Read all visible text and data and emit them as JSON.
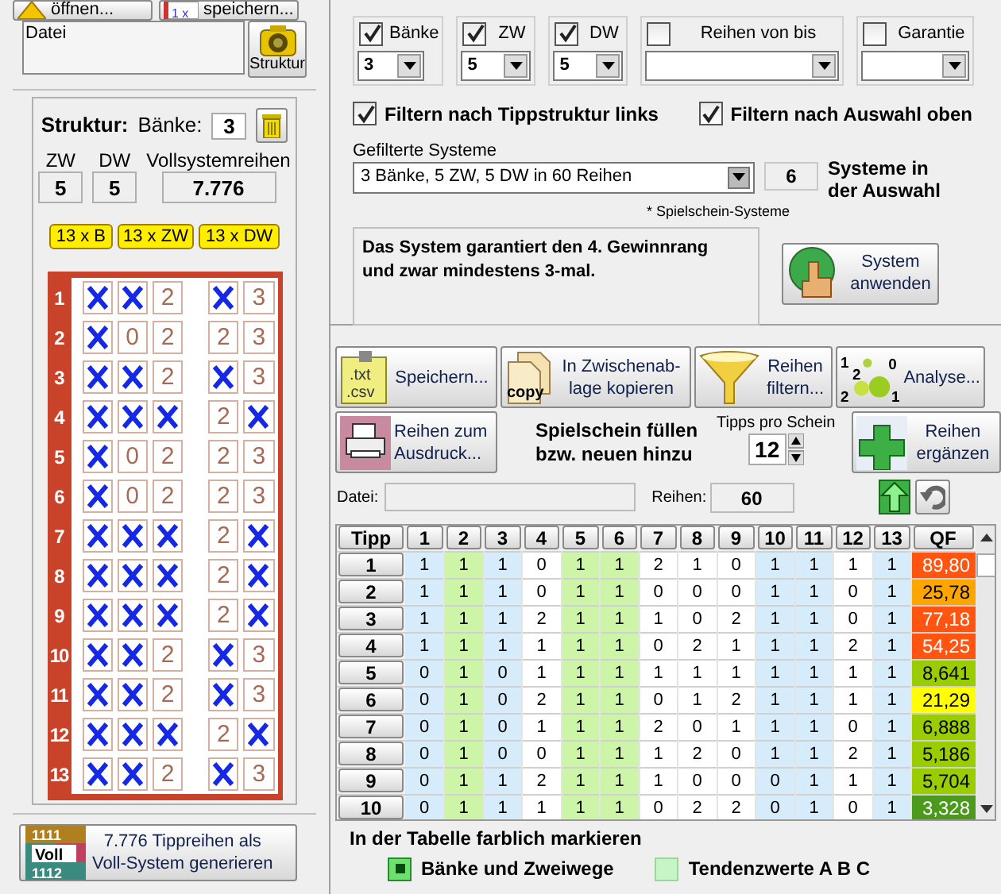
{
  "file_buttons": [
    {
      "label": "öffnen..."
    },
    {
      "label": "speichern...",
      "icon_text": "1 x"
    }
  ],
  "file": {
    "label": "Datei"
  },
  "structure_button": {
    "label": "Struktur"
  },
  "structure": {
    "title": "Struktur:",
    "banks_label": "Bänke:",
    "banks": "3",
    "zw_label": "ZW",
    "zw": "5",
    "dw_label": "DW",
    "dw": "5",
    "full_label": "Vollsystemreihen",
    "full": "7.776"
  },
  "fill_buttons": [
    "13 x B",
    "13 x ZW",
    "13 x DW"
  ],
  "ticket": {
    "rows": [
      {
        "number": "1",
        "cells": [
          {
            "crossed": true
          },
          {
            "crossed": true
          },
          {
            "digit": "2",
            "crossed": false
          },
          {
            "crossed": true
          },
          {
            "digit": "3",
            "crossed": false
          }
        ]
      },
      {
        "number": "2",
        "cells": [
          {
            "crossed": true
          },
          {
            "digit": "0",
            "crossed": false
          },
          {
            "digit": "2",
            "crossed": false
          },
          {
            "digit": "2",
            "crossed": false
          },
          {
            "digit": "3",
            "crossed": false
          }
        ]
      },
      {
        "number": "3",
        "cells": [
          {
            "crossed": true
          },
          {
            "crossed": true
          },
          {
            "digit": "2",
            "crossed": false
          },
          {
            "crossed": true
          },
          {
            "digit": "3",
            "crossed": false
          }
        ]
      },
      {
        "number": "4",
        "cells": [
          {
            "crossed": true
          },
          {
            "crossed": true
          },
          {
            "crossed": true
          },
          {
            "digit": "2",
            "crossed": false
          },
          {
            "crossed": true
          }
        ]
      },
      {
        "number": "5",
        "cells": [
          {
            "crossed": true
          },
          {
            "digit": "0",
            "crossed": false
          },
          {
            "digit": "2",
            "crossed": false
          },
          {
            "digit": "2",
            "crossed": false
          },
          {
            "digit": "3",
            "crossed": false
          }
        ]
      },
      {
        "number": "6",
        "cells": [
          {
            "crossed": true
          },
          {
            "digit": "0",
            "crossed": false
          },
          {
            "digit": "2",
            "crossed": false
          },
          {
            "digit": "2",
            "crossed": false
          },
          {
            "digit": "3",
            "crossed": false
          }
        ]
      },
      {
        "number": "7",
        "cells": [
          {
            "crossed": true
          },
          {
            "crossed": true
          },
          {
            "crossed": true
          },
          {
            "digit": "2",
            "crossed": false
          },
          {
            "crossed": true
          }
        ]
      },
      {
        "number": "8",
        "cells": [
          {
            "crossed": true
          },
          {
            "crossed": true
          },
          {
            "crossed": true
          },
          {
            "digit": "2",
            "crossed": false
          },
          {
            "crossed": true
          }
        ]
      },
      {
        "number": "9",
        "cells": [
          {
            "crossed": true
          },
          {
            "crossed": true
          },
          {
            "crossed": true
          },
          {
            "digit": "2",
            "crossed": false
          },
          {
            "crossed": true
          }
        ]
      },
      {
        "number": "10",
        "cells": [
          {
            "crossed": true
          },
          {
            "crossed": true
          },
          {
            "digit": "2",
            "crossed": false
          },
          {
            "crossed": true
          },
          {
            "digit": "3",
            "crossed": false
          }
        ]
      },
      {
        "number": "11",
        "cells": [
          {
            "crossed": true
          },
          {
            "crossed": true
          },
          {
            "digit": "2",
            "crossed": false
          },
          {
            "crossed": true
          },
          {
            "digit": "3",
            "crossed": false
          }
        ]
      },
      {
        "number": "12",
        "cells": [
          {
            "crossed": true
          },
          {
            "crossed": true
          },
          {
            "crossed": true
          },
          {
            "digit": "2",
            "crossed": false
          },
          {
            "crossed": true
          }
        ]
      },
      {
        "number": "13",
        "cells": [
          {
            "crossed": true
          },
          {
            "crossed": true
          },
          {
            "digit": "2",
            "crossed": false
          },
          {
            "crossed": true
          },
          {
            "digit": "3",
            "crossed": false
          }
        ]
      }
    ]
  },
  "generate_button": {
    "label": "7.776 Tippreihen als\nVoll-System generieren",
    "icon_rows": [
      "1111",
      "1112"
    ],
    "icon_text": "Voll"
  },
  "filters": [
    {
      "label": "Bänke",
      "checked": true,
      "value": "3"
    },
    {
      "label": "ZW",
      "checked": true,
      "value": "5"
    },
    {
      "label": "DW",
      "checked": true,
      "value": "5"
    },
    {
      "label": "Reihen von bis",
      "checked": false
    },
    {
      "label": "Garantie",
      "checked": false
    }
  ],
  "filter_options": [
    {
      "label": "Filtern nach Tippstruktur links",
      "checked": true
    },
    {
      "label": "Filtern nach Auswahl oben",
      "checked": true
    }
  ],
  "systems": {
    "label": "Gefilterte Systeme",
    "value": "3 Bänke, 5 ZW, 5 DW in 60 Reihen",
    "count": "6",
    "count_label": "Systeme in\nder Auswahl",
    "note": "* Spielschein-Systeme"
  },
  "description": "Das System garantiert den 4. Gewinnrang und zwar mindestens 3-mal.",
  "apply_button": {
    "label": "System\nanwenden"
  },
  "toolbar": [
    {
      "kind": "save",
      "label": "Speichern...",
      "icon_text": [
        ".txt",
        ".csv"
      ]
    },
    {
      "kind": "copy",
      "label": "In Zwischenab-\nlage kopieren",
      "icon_text": [
        "copy"
      ]
    },
    {
      "kind": "filter",
      "label": "Reihen\nfiltern..."
    },
    {
      "kind": "analysis",
      "label": "Analyse...",
      "icon_text": [
        "1",
        "2",
        "0",
        "2",
        "1"
      ]
    }
  ],
  "print_button": {
    "label": "Reihen zum\nAusdruck..."
  },
  "fill_text": "Spielschein füllen\nbzw. neuen hinzu",
  "tips_per_ticket": {
    "label": "Tipps pro Schein",
    "value": "12"
  },
  "add_button": {
    "label": "Reihen\nergänzen"
  },
  "result_file": {
    "label": "Datei:",
    "rows_label": "Reihen:",
    "rows": "60"
  },
  "table": {
    "columns": [
      {
        "label": "Tipp"
      },
      {
        "label": "1",
        "color": "#d6ecfb"
      },
      {
        "label": "2",
        "color": "#ccf5a8"
      },
      {
        "label": "3",
        "color": "#d6ecfb"
      },
      {
        "label": "4",
        "color": "#ffffff"
      },
      {
        "label": "5",
        "color": "#ccf5a8"
      },
      {
        "label": "6",
        "color": "#ccf5a8"
      },
      {
        "label": "7",
        "color": "#ffffff"
      },
      {
        "label": "8",
        "color": "#ffffff"
      },
      {
        "label": "9",
        "color": "#ffffff"
      },
      {
        "label": "10",
        "color": "#d6ecfb"
      },
      {
        "label": "11",
        "color": "#d6ecfb"
      },
      {
        "label": "12",
        "color": "#ffffff"
      },
      {
        "label": "13",
        "color": "#d6ecfb"
      },
      {
        "label": "QF"
      }
    ],
    "rows": [
      {
        "tipp": "1",
        "values": [
          "1",
          "1",
          "1",
          "0",
          "1",
          "1",
          "2",
          "1",
          "0",
          "1",
          "1",
          "1",
          "1"
        ],
        "qf": "89,80",
        "color": "#ff5511"
      },
      {
        "tipp": "2",
        "values": [
          "1",
          "1",
          "1",
          "0",
          "1",
          "1",
          "0",
          "0",
          "0",
          "1",
          "1",
          "0",
          "1"
        ],
        "qf": "25,78",
        "color": "#ffa500"
      },
      {
        "tipp": "3",
        "values": [
          "1",
          "1",
          "1",
          "2",
          "1",
          "1",
          "1",
          "0",
          "2",
          "1",
          "1",
          "0",
          "1"
        ],
        "qf": "77,18",
        "color": "#ff5511"
      },
      {
        "tipp": "4",
        "values": [
          "1",
          "1",
          "1",
          "1",
          "1",
          "1",
          "0",
          "2",
          "1",
          "1",
          "1",
          "2",
          "1"
        ],
        "qf": "54,25",
        "color": "#ff5511"
      },
      {
        "tipp": "5",
        "values": [
          "0",
          "1",
          "0",
          "1",
          "1",
          "1",
          "1",
          "1",
          "1",
          "1",
          "1",
          "1",
          "1"
        ],
        "qf": "8,641",
        "color": "#9acd00"
      },
      {
        "tipp": "6",
        "values": [
          "0",
          "1",
          "0",
          "2",
          "1",
          "1",
          "0",
          "1",
          "2",
          "1",
          "1",
          "1",
          "1"
        ],
        "qf": "21,29",
        "color": "#ffff00"
      },
      {
        "tipp": "7",
        "values": [
          "0",
          "1",
          "0",
          "1",
          "1",
          "1",
          "2",
          "0",
          "1",
          "1",
          "1",
          "0",
          "1"
        ],
        "qf": "6,888",
        "color": "#9acd00"
      },
      {
        "tipp": "8",
        "values": [
          "0",
          "1",
          "0",
          "0",
          "1",
          "1",
          "1",
          "2",
          "0",
          "1",
          "1",
          "2",
          "1"
        ],
        "qf": "5,186",
        "color": "#9acd00"
      },
      {
        "tipp": "9",
        "values": [
          "0",
          "1",
          "1",
          "2",
          "1",
          "1",
          "1",
          "0",
          "0",
          "0",
          "1",
          "1",
          "1"
        ],
        "qf": "5,704",
        "color": "#9acd00"
      },
      {
        "tipp": "10",
        "values": [
          "0",
          "1",
          "1",
          "1",
          "1",
          "1",
          "0",
          "2",
          "2",
          "0",
          "1",
          "0",
          "1"
        ],
        "qf": "3,328",
        "color": "#4c9a1c"
      }
    ]
  },
  "legend": {
    "title": "In der Tabelle farblich markieren",
    "items": [
      {
        "label": "Bänke und Zweiwege",
        "checked": true
      },
      {
        "label": "Tendenzwerte A B C",
        "checked": false
      }
    ]
  }
}
